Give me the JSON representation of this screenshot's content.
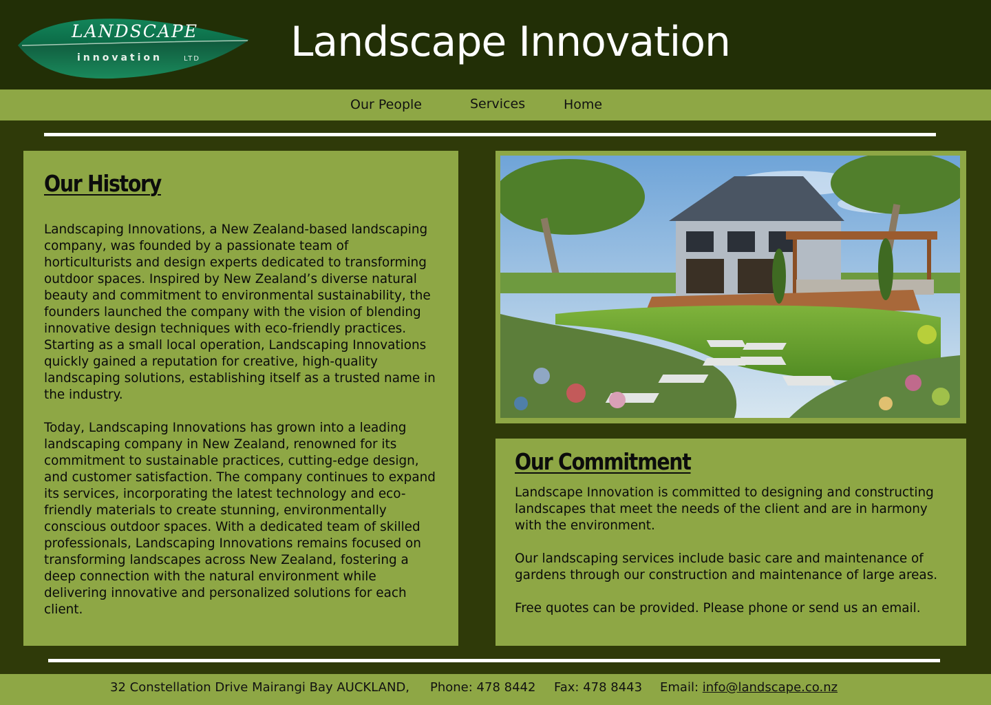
{
  "brand": {
    "logo_word": "LANDSCAPE",
    "logo_sub": "innovation",
    "logo_ltd": "LTD",
    "site_title": "Landscape Innovation"
  },
  "nav": {
    "items": [
      {
        "label": "Our People"
      },
      {
        "label": "Services"
      },
      {
        "label": "Home"
      }
    ]
  },
  "history": {
    "heading": "Our History",
    "paragraphs": [
      "Landscaping Innovations, a New Zealand-based landscaping company, was founded by a passionate team of horticulturists and design experts dedicated to transforming outdoor spaces. Inspired by New Zealand’s diverse natural beauty and commitment to environmental sustainability, the founders launched the company with the vision of blending innovative design techniques with eco-friendly practices. Starting as a small local operation, Landscaping Innovations quickly gained a reputation for creative, high-quality landscaping solutions, establishing itself as a trusted name in the industry.",
      "Today, Landscaping Innovations has grown into a leading landscaping company in New Zealand, renowned for its commitment to sustainable practices, cutting-edge design, and customer satisfaction. The company continues to expand its services, incorporating the latest technology and eco-friendly materials to create stunning, environmentally conscious outdoor spaces. With a dedicated team of skilled professionals, Landscaping Innovations remains focused on transforming landscapes across New Zealand, fostering a deep connection with the natural environment while delivering innovative and personalized solutions for each client."
    ]
  },
  "commitment": {
    "heading": "Our Commitment",
    "paragraphs": [
      "Landscape Innovation is committed to designing and constructing landscapes that meet the needs of the client and are in harmony with the environment.",
      "Our landscaping services include basic care and maintenance of gardens through our construction and maintenance of large areas.",
      "Free quotes can be provided. Please phone or send us an email."
    ]
  },
  "footer": {
    "address": "32 Constellation Drive Mairangi Bay AUCKLAND,",
    "phone": "Phone: 478 8442",
    "fax": "Fax: 478 8443",
    "email_label": "Email: ",
    "email": "info@landscape.co.nz"
  },
  "colors": {
    "header_bg": "#222f06",
    "page_bg": "#2f3a09",
    "panel_green": "#8ea745",
    "logo_green": "#0e7a52"
  }
}
